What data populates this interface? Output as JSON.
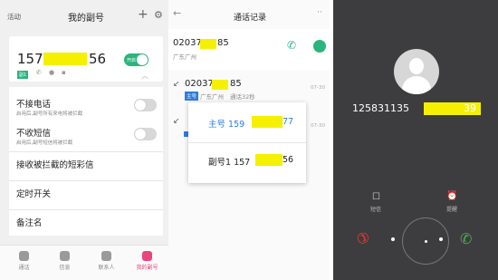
{
  "left": {
    "back": "活动",
    "title": "我的副号",
    "number_prefix": "157",
    "number_suffix": "56",
    "badge": "副1",
    "toggle_text": "开启",
    "rows": [
      {
        "label": "不接电话",
        "desc": "启用后,副号所有来电将被拦截"
      },
      {
        "label": "不收短信",
        "desc": "启用后,副号短信将被拦截"
      }
    ],
    "links": [
      "接收被拦截的短彩信",
      "定时开关",
      "备注名"
    ],
    "nav": [
      "通话",
      "信息",
      "联系人",
      "我的副号"
    ]
  },
  "mid": {
    "title": "通话记录",
    "more": "··",
    "rec1": {
      "prefix": "02037",
      "suffix": "85",
      "loc": "广东广州"
    },
    "rec2": {
      "prefix": "02037",
      "suffix": "85",
      "tag": "主号",
      "loc": "广东广州",
      "dur": "通话32秒",
      "time": "07-30"
    },
    "rec3": {
      "time": "07-30"
    },
    "popup": {
      "main_prefix": "主号 159",
      "main_suffix": "77",
      "sub_prefix": "副号1 157",
      "sub_suffix": "56"
    }
  },
  "right": {
    "num_prefix": "125831135",
    "num_suffix": "39",
    "msg": "短信",
    "remind": "提醒"
  }
}
